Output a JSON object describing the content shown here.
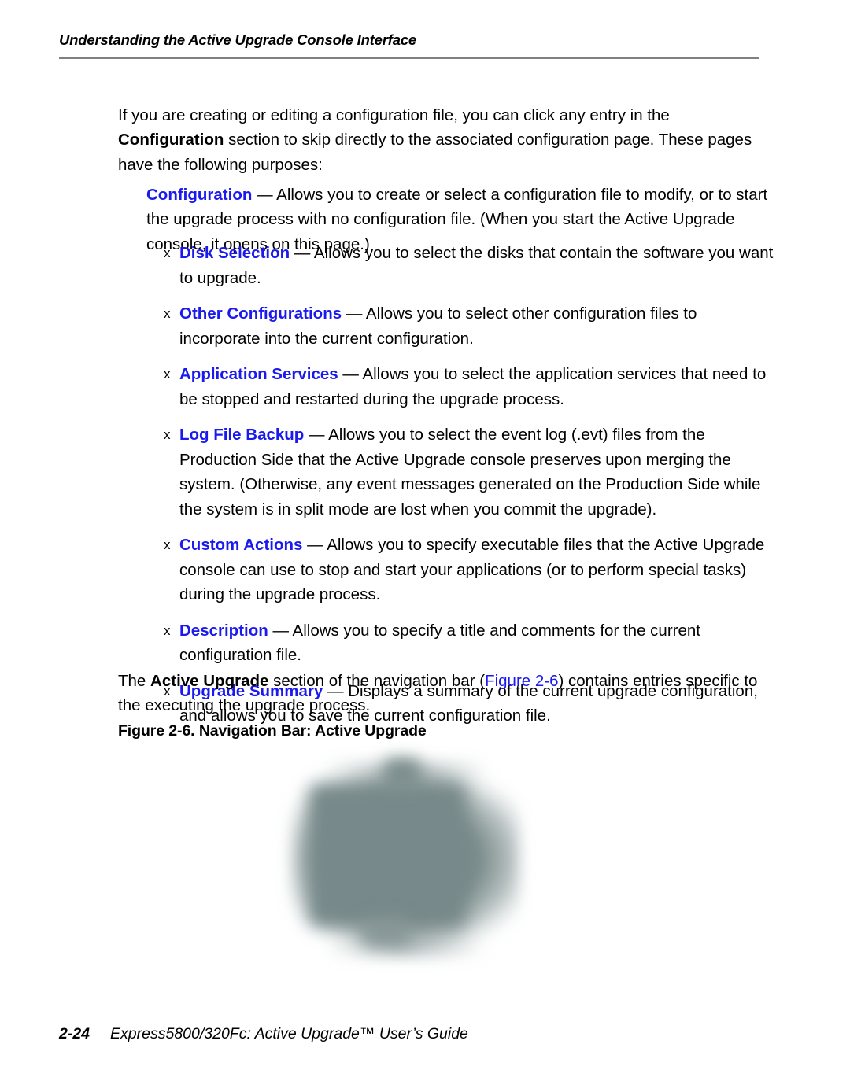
{
  "page": {
    "header_text": "Understanding the Active Upgrade Console Interface",
    "intro_paragraph": {
      "before_bold": "If you are creating or editing a configuration file, you can click any entry in the ",
      "bold": "Configuration",
      "after_bold": " section to skip directly to the associated configuration page. These pages have the following purposes:"
    },
    "lead_item": {
      "term": "Configuration",
      "dash": " — ",
      "description": "Allows you to create or select a configuration file to modify, or to start the upgrade process with no configuration file. (When you start the Active Upgrade console, it opens on this page.)"
    },
    "bullet_marker": "x",
    "items": [
      {
        "term": "Disk Selection",
        "dash": " — ",
        "description": "Allows you to select the disks that contain the software you want to upgrade."
      },
      {
        "term": "Other Configurations",
        "dash": " — ",
        "description": "Allows you to select other configuration files to incorporate into the current configuration."
      },
      {
        "term": "Application Services",
        "dash": " — ",
        "description": "Allows you to select the application services that need to be stopped and restarted during the upgrade process."
      },
      {
        "term": "Log File Backup",
        "dash": " — ",
        "description": "Allows you to select the event log (.evt) files from the Production Side that the Active Upgrade console preserves upon merging the system. (Otherwise, any event messages generated on the Production Side while the system is in split mode are lost when you commit the upgrade)."
      },
      {
        "term": "Custom Actions",
        "dash": " — ",
        "description": "Allows you to specify executable files that the Active Upgrade console can use to stop and start your applications (or to perform special tasks) during the upgrade process."
      },
      {
        "term": "Description",
        "dash": " — ",
        "description": "Allows you to specify a title and comments for the current configuration file."
      },
      {
        "term": "Upgrade Summary",
        "dash": " — ",
        "description": "Displays a summary of the current upgrade configuration, and allows you to save the current configuration file."
      }
    ],
    "closing_paragraph": {
      "part1": "The ",
      "bold": "Active Upgrade",
      "part2": " section of the navigation bar (",
      "xref": "Figure 2-6",
      "part3": ") contains entries specific to the executing the upgrade process."
    },
    "figure": {
      "caption": "Figure 2-6. Navigation Bar: Active Upgrade",
      "image_alt": "navigation-bar-screenshot"
    },
    "footer": {
      "page_number": "2-24",
      "title": "Express5800/320Fc: Active Upgrade™ User’s Guide"
    },
    "colors": {
      "term_blue": "#1a1aee",
      "xref_blue": "#1a1aee",
      "rule_gray": "#808080",
      "figure_blob": "#7a8b8b",
      "text_black": "#000000"
    }
  }
}
